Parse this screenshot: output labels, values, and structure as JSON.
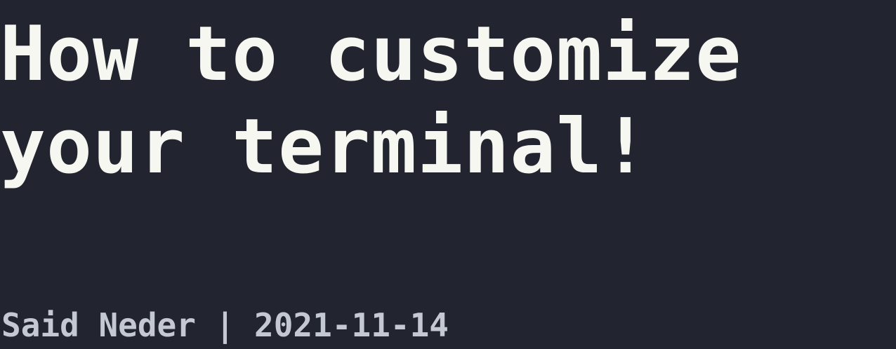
{
  "post": {
    "title_line_1": "How to customize",
    "title_line_2": "your terminal!",
    "byline": "Said Neder | 2021-11-14"
  },
  "colors": {
    "background": "#22252f",
    "title": "#f7f7f2",
    "byline": "#c3c8d2"
  }
}
